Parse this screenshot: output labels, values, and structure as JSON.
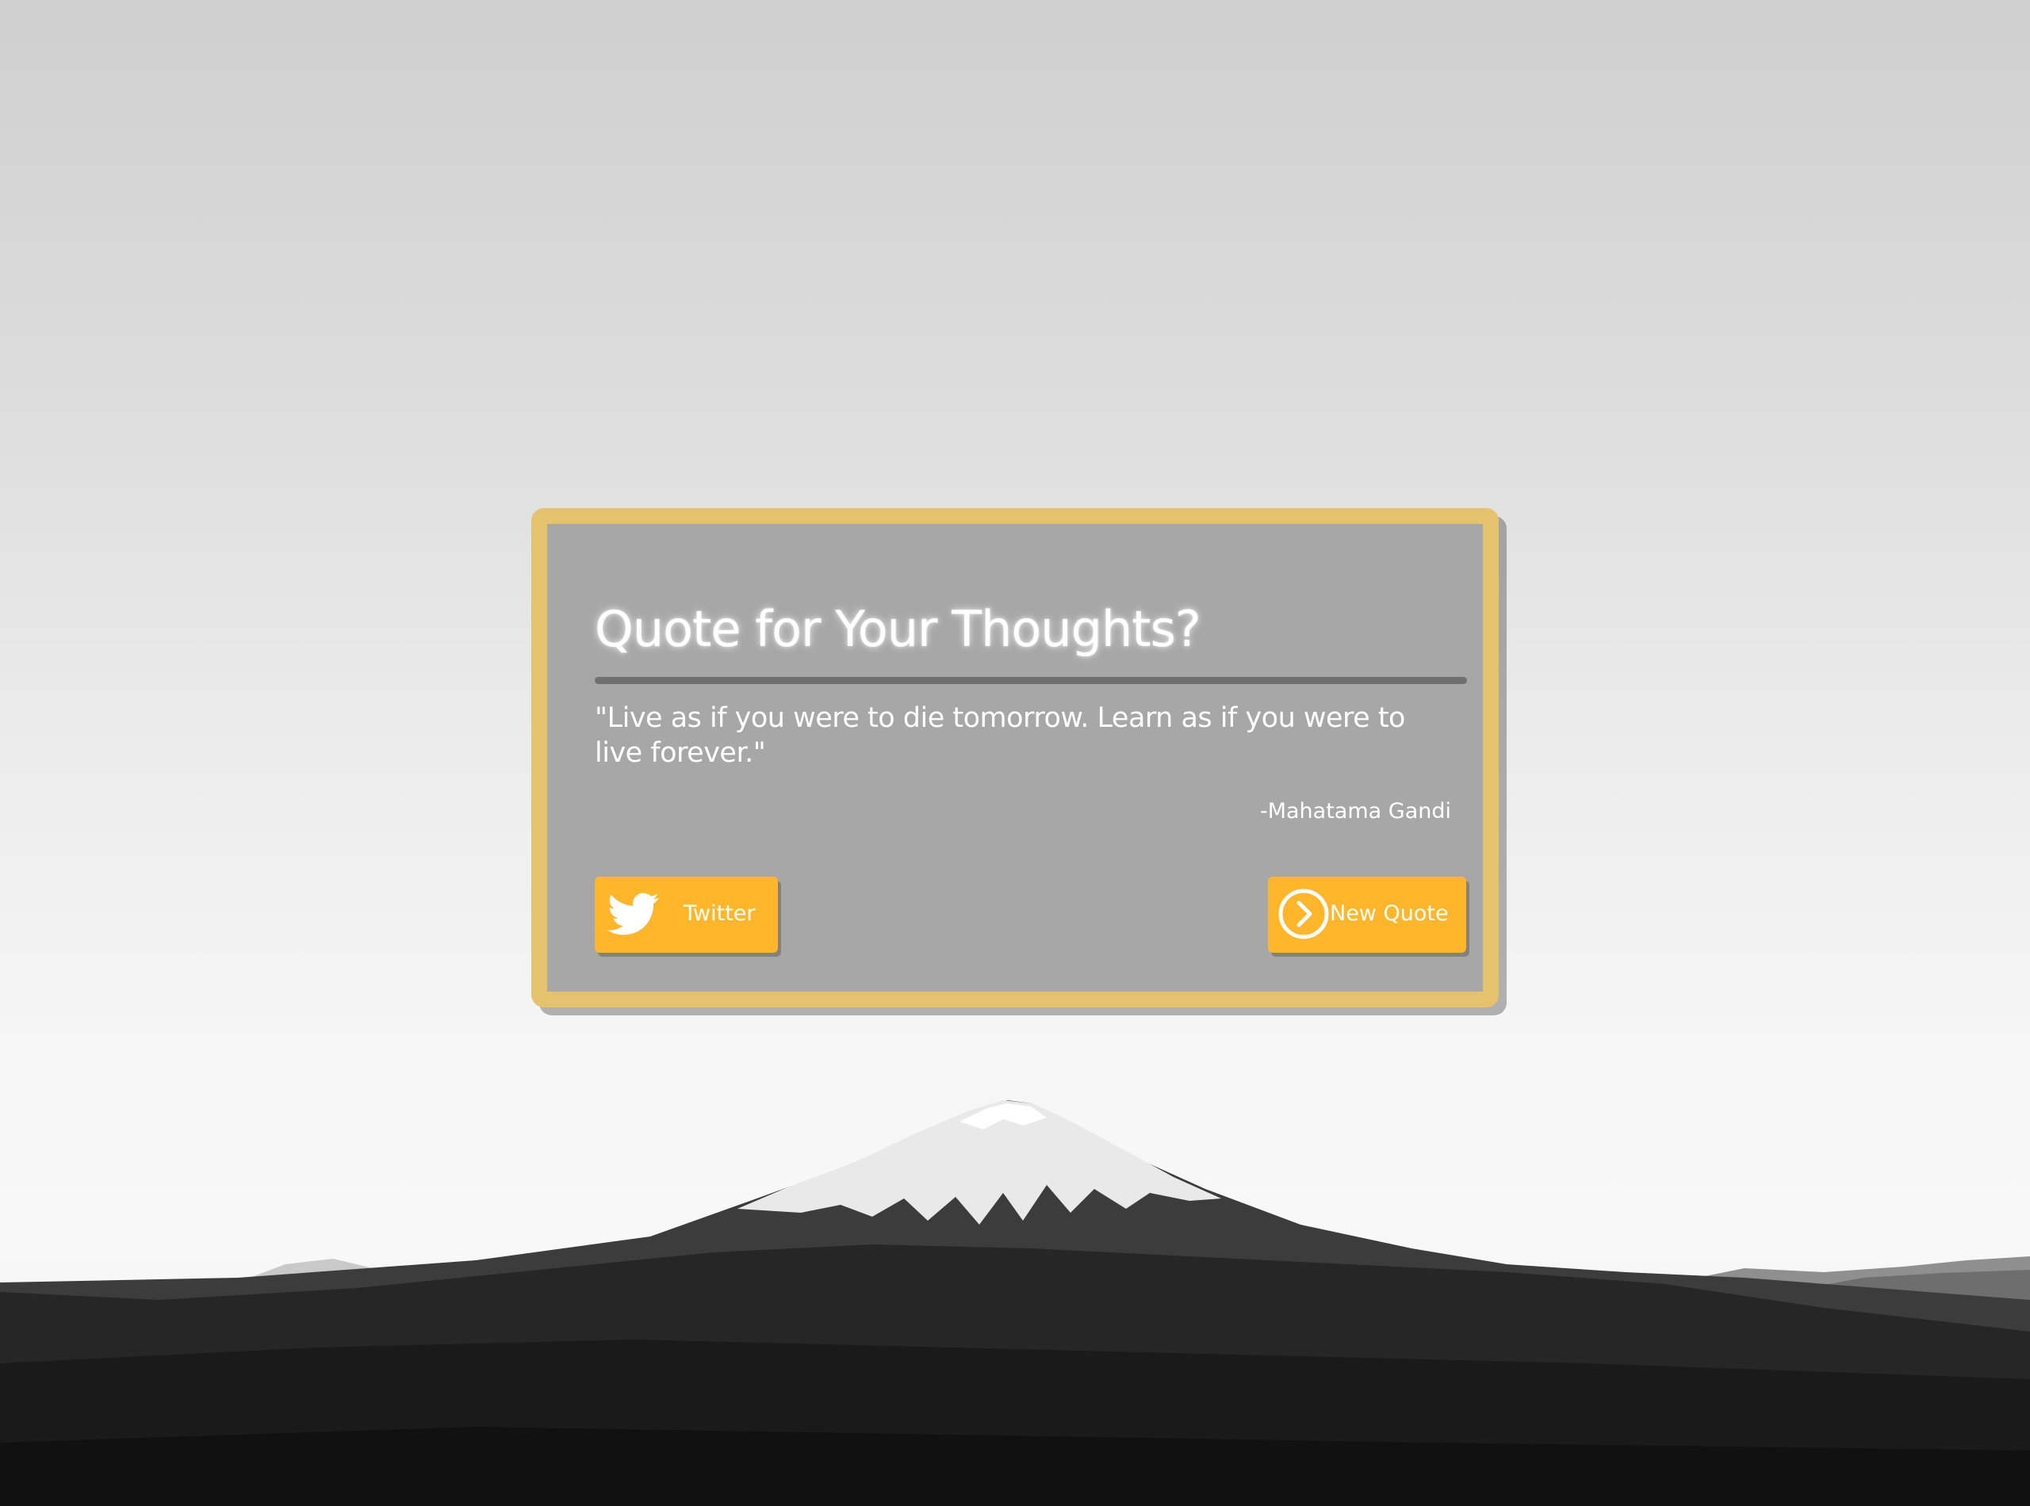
{
  "colors": {
    "card_background": "#a7a7a7",
    "card_border": "#e5c36e",
    "button_background": "#ffb62a",
    "title_rule": "#6f6f6f",
    "text": "#ffffff"
  },
  "card": {
    "title": "Quote for Your Thoughts?",
    "quote": "\"Live as if you were to die tomorrow. Learn as if you were to live forever.\"",
    "author": "-Mahatama Gandi"
  },
  "buttons": {
    "twitter": {
      "label": "Twitter",
      "icon": "twitter-bird-icon"
    },
    "new_quote": {
      "label": "New Quote",
      "icon": "chevron-right-circle-icon"
    }
  }
}
